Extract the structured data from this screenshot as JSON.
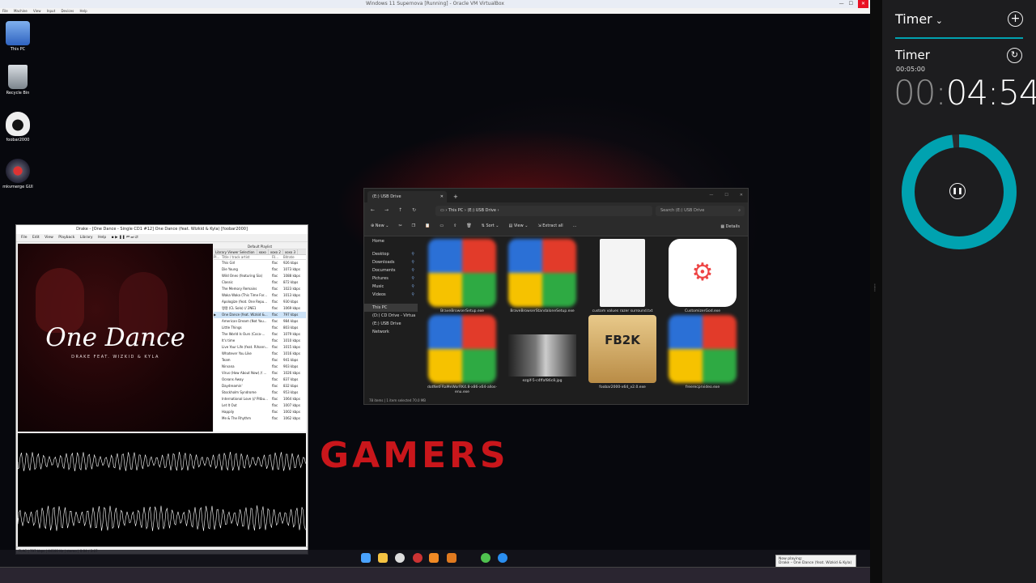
{
  "vm": {
    "title": "Windows 11 Supernova [Running] - Oracle VM VirtualBox",
    "menu": [
      "File",
      "Machine",
      "View",
      "Input",
      "Devices",
      "Help"
    ]
  },
  "desktop_icons": [
    {
      "label": "This PC",
      "icon": "computer-icon",
      "color": "#3f7bd6"
    },
    {
      "label": "Recycle Bin",
      "icon": "recycle-bin-icon",
      "color": "#9aa4ad"
    },
    {
      "label": "foobar2000",
      "icon": "foobar-icon",
      "color": "#eaeaea"
    },
    {
      "label": "mkvmerge GUI",
      "icon": "mkvmerge-icon",
      "color": "#c22c2c"
    }
  ],
  "foobar": {
    "title": "Drake - [One Dance - Single CD1 #12] One Dance (feat. Wizkid & Kyla) [foobar2000]",
    "menu": [
      "File",
      "Edit",
      "View",
      "Playback",
      "Library",
      "Help"
    ],
    "art_title": "One Dance",
    "art_subtitle": "DRAKE FEAT. WIZKID & KYLA",
    "playlist_header": "Default Playlist",
    "tabs": [
      "Library Viewer Selection",
      "xoxo",
      "xoxo 2",
      "xoxo 3"
    ],
    "columns": [
      "Pl...",
      "Title / track artist",
      "Fil...",
      "Bitrate"
    ],
    "rows": [
      {
        "title": "This Girl",
        "fmt": "flac",
        "bitrate": "926 kbps"
      },
      {
        "title": "Die Young",
        "fmt": "flac",
        "bitrate": "1073 kbps"
      },
      {
        "title": "Wild Ones (featuring Sia)",
        "fmt": "flac",
        "bitrate": "1088 kbps"
      },
      {
        "title": "Classic",
        "fmt": "flac",
        "bitrate": "872 kbps"
      },
      {
        "title": "The Memory Remains",
        "fmt": "flac",
        "bitrate": "1023 kbps"
      },
      {
        "title": "Waka Waka (This Time For...",
        "fmt": "flac",
        "bitrate": "1013 kbps"
      },
      {
        "title": "Apologize (feat. One Repu...",
        "fmt": "flac",
        "bitrate": "930 kbps"
      },
      {
        "title": "땡땡 (CL Solo) // 2NE1",
        "fmt": "flac",
        "bitrate": "1069 kbps"
      },
      {
        "title": "One Dance (feat. Wizkid &...",
        "fmt": "flac",
        "bitrate": "797 kbps",
        "selected": true
      },
      {
        "title": "American Dream (Not You...",
        "fmt": "flac",
        "bitrate": "984 kbps"
      },
      {
        "title": "Little Things",
        "fmt": "flac",
        "bitrate": "803 kbps"
      },
      {
        "title": "The World Is Ours (Coca-...",
        "fmt": "flac",
        "bitrate": "1079 kbps"
      },
      {
        "title": "It's time",
        "fmt": "flac",
        "bitrate": "1010 kbps"
      },
      {
        "title": "Live Your Life (feat. Rihann...",
        "fmt": "flac",
        "bitrate": "1015 kbps"
      },
      {
        "title": "Whatever You Like",
        "fmt": "flac",
        "bitrate": "1016 kbps"
      },
      {
        "title": "Team",
        "fmt": "flac",
        "bitrate": "941 kbps"
      },
      {
        "title": "Nirvana",
        "fmt": "flac",
        "bitrate": "903 kbps"
      },
      {
        "title": "Virus (How About Now) // ...",
        "fmt": "flac",
        "bitrate": "1026 kbps"
      },
      {
        "title": "Oceans Away",
        "fmt": "flac",
        "bitrate": "837 kbps"
      },
      {
        "title": "Daydreamin'",
        "fmt": "flac",
        "bitrate": "832 kbps"
      },
      {
        "title": "Stockholm Syndrome",
        "fmt": "flac",
        "bitrate": "953 kbps"
      },
      {
        "title": "International Love (// Pitbu...",
        "fmt": "flac",
        "bitrate": "1064 kbps"
      },
      {
        "title": "Let It Out",
        "fmt": "flac",
        "bitrate": "1007 kbps"
      },
      {
        "title": "Happily",
        "fmt": "flac",
        "bitrate": "1002 kbps"
      },
      {
        "title": "Me & The Rhythm",
        "fmt": "flac",
        "bitrate": "1062 kbps"
      }
    ],
    "status": "FLAC | 797 kbps | 44100 Hz | stereo | 0:04 / 3:07"
  },
  "explorer": {
    "tab_label": "(E:) USB Drive",
    "breadcrumb": [
      "This PC",
      "(E:) USB Drive"
    ],
    "search_placeholder": "Search (E:) USB Drive",
    "commands": [
      "New",
      "Sort",
      "View",
      "Extract all",
      "..."
    ],
    "details_label": "Details",
    "nav": [
      {
        "label": "Home"
      },
      {
        "label": "Desktop",
        "pinned": true
      },
      {
        "label": "Downloads",
        "pinned": true
      },
      {
        "label": "Documents",
        "pinned": true
      },
      {
        "label": "Pictures",
        "pinned": true
      },
      {
        "label": "Music",
        "pinned": true
      },
      {
        "label": "Videos",
        "pinned": true
      },
      {
        "label": "This PC",
        "selected": true
      },
      {
        "label": "(D:) CD Drive - Virtua"
      },
      {
        "label": "(E:) USB Drive"
      },
      {
        "label": "Network"
      }
    ],
    "files": [
      {
        "name": "BraveBrowserSetup.exe",
        "kind": "installer"
      },
      {
        "name": "BraveBrowserStandaloneSetup.exe",
        "kind": "installer"
      },
      {
        "name": "custom values razer surround.txt",
        "kind": "text"
      },
      {
        "name": "CustomizerGod.exe",
        "kind": "gear"
      },
      {
        "name": "dotNetFRaMeWorRK4.8-x86-x64-allos-enu.exe",
        "kind": "installer"
      },
      {
        "name": "ezgif-5-c4ffaf86c8.jpg",
        "kind": "photo"
      },
      {
        "name": "foobar2000-x64_v2.0.exe",
        "kind": "fb2k"
      },
      {
        "name": "freerecprvideo.exe",
        "kind": "installer"
      }
    ],
    "status": "78 items  |  1 item selected  70.0 MB"
  },
  "notification": {
    "title": "Now playing:",
    "text": "Drake – One Dance (feat. Wizkid & Kyla)"
  },
  "timer": {
    "header": "Timer",
    "name": "Timer",
    "original": "00:05:00",
    "remaining_hours": "00",
    "remaining_rest": "04:54",
    "progress_remaining": 0.98,
    "accent": "#00a2b0"
  }
}
